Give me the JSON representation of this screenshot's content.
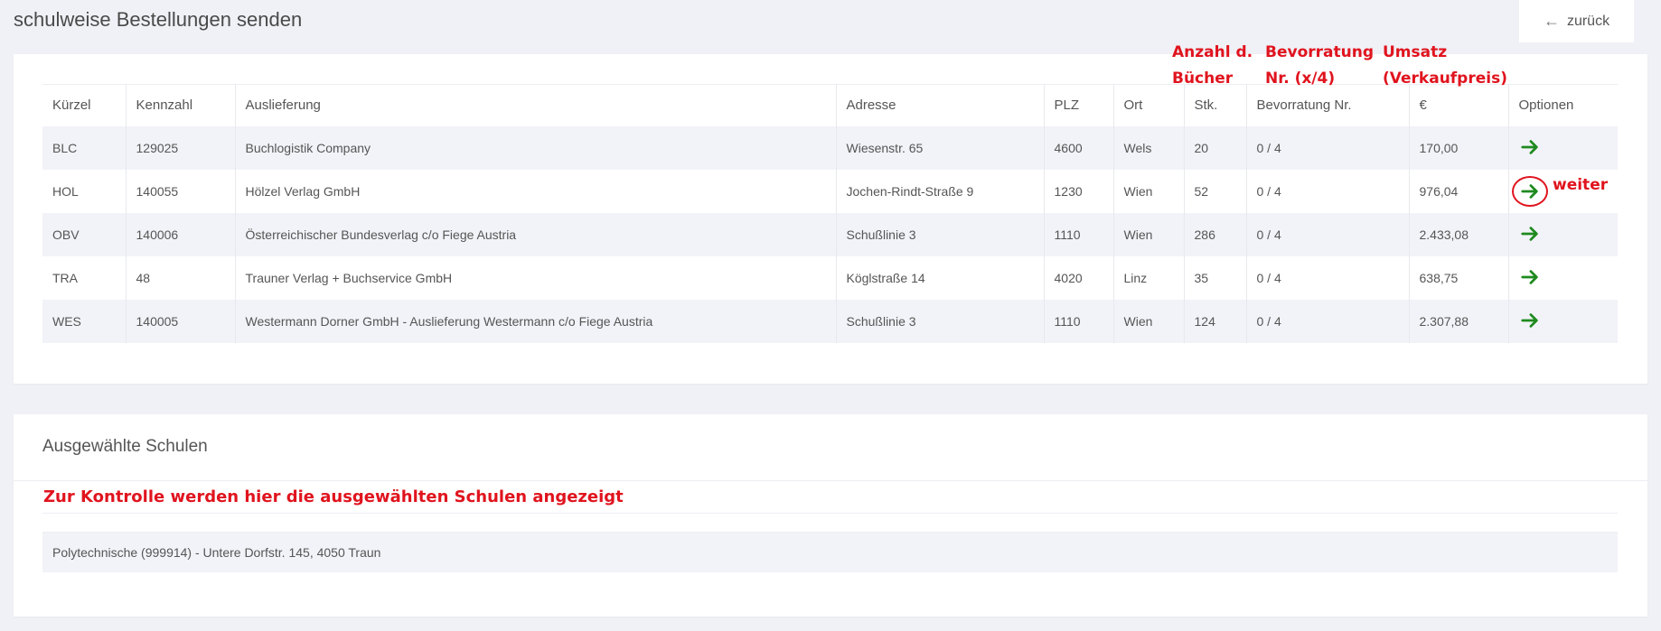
{
  "page": {
    "title": "schulweise Bestellungen senden",
    "back_label": "zurück"
  },
  "annotations": {
    "col_stk": [
      "Anzahl d.",
      "Bücher"
    ],
    "col_bevorratung": [
      "Bevorratung",
      "Nr. (x/4)"
    ],
    "col_umsatz": [
      "Umsatz",
      "(Verkaufpreis)"
    ],
    "weiter": "weiter",
    "schools_note": "Zur Kontrolle werden hier die ausgewählten Schulen angezeigt",
    "color": "#e0141e"
  },
  "orders": {
    "headers": [
      "Kürzel",
      "Kennzahl",
      "Auslieferung",
      "Adresse",
      "PLZ",
      "Ort",
      "Stk.",
      "Bevorratung Nr.",
      "€",
      "Optionen"
    ],
    "rows": [
      [
        "BLC",
        "129025",
        "Buchlogistik Company",
        "Wiesenstr. 65",
        "4600",
        "Wels",
        "20",
        "0 / 4",
        "170,00"
      ],
      [
        "HOL",
        "140055",
        "Hölzel Verlag GmbH",
        "Jochen-Rindt-Straße 9",
        "1230",
        "Wien",
        "52",
        "0 / 4",
        "976,04"
      ],
      [
        "OBV",
        "140006",
        "Österreichischer Bundesverlag c/o Fiege Austria",
        "Schußlinie 3",
        "1110",
        "Wien",
        "286",
        "0 / 4",
        "2.433,08"
      ],
      [
        "TRA",
        "48",
        "Trauner Verlag + Buchservice GmbH",
        "Köglstraße 14",
        "4020",
        "Linz",
        "35",
        "0 / 4",
        "638,75"
      ],
      [
        "WES",
        "140005",
        "Westermann Dorner GmbH - Auslieferung Westermann c/o Fiege Austria",
        "Schußlinie 3",
        "1110",
        "Wien",
        "124",
        "0 / 4",
        "2.307,88"
      ]
    ],
    "action_icon": "arrow-right-icon",
    "action_color": "#1e8a1e"
  },
  "schools": {
    "title": "Ausgewählte Schulen",
    "items": [
      "Polytechnische (999914) - Untere Dorfstr. 145, 4050 Traun"
    ]
  }
}
